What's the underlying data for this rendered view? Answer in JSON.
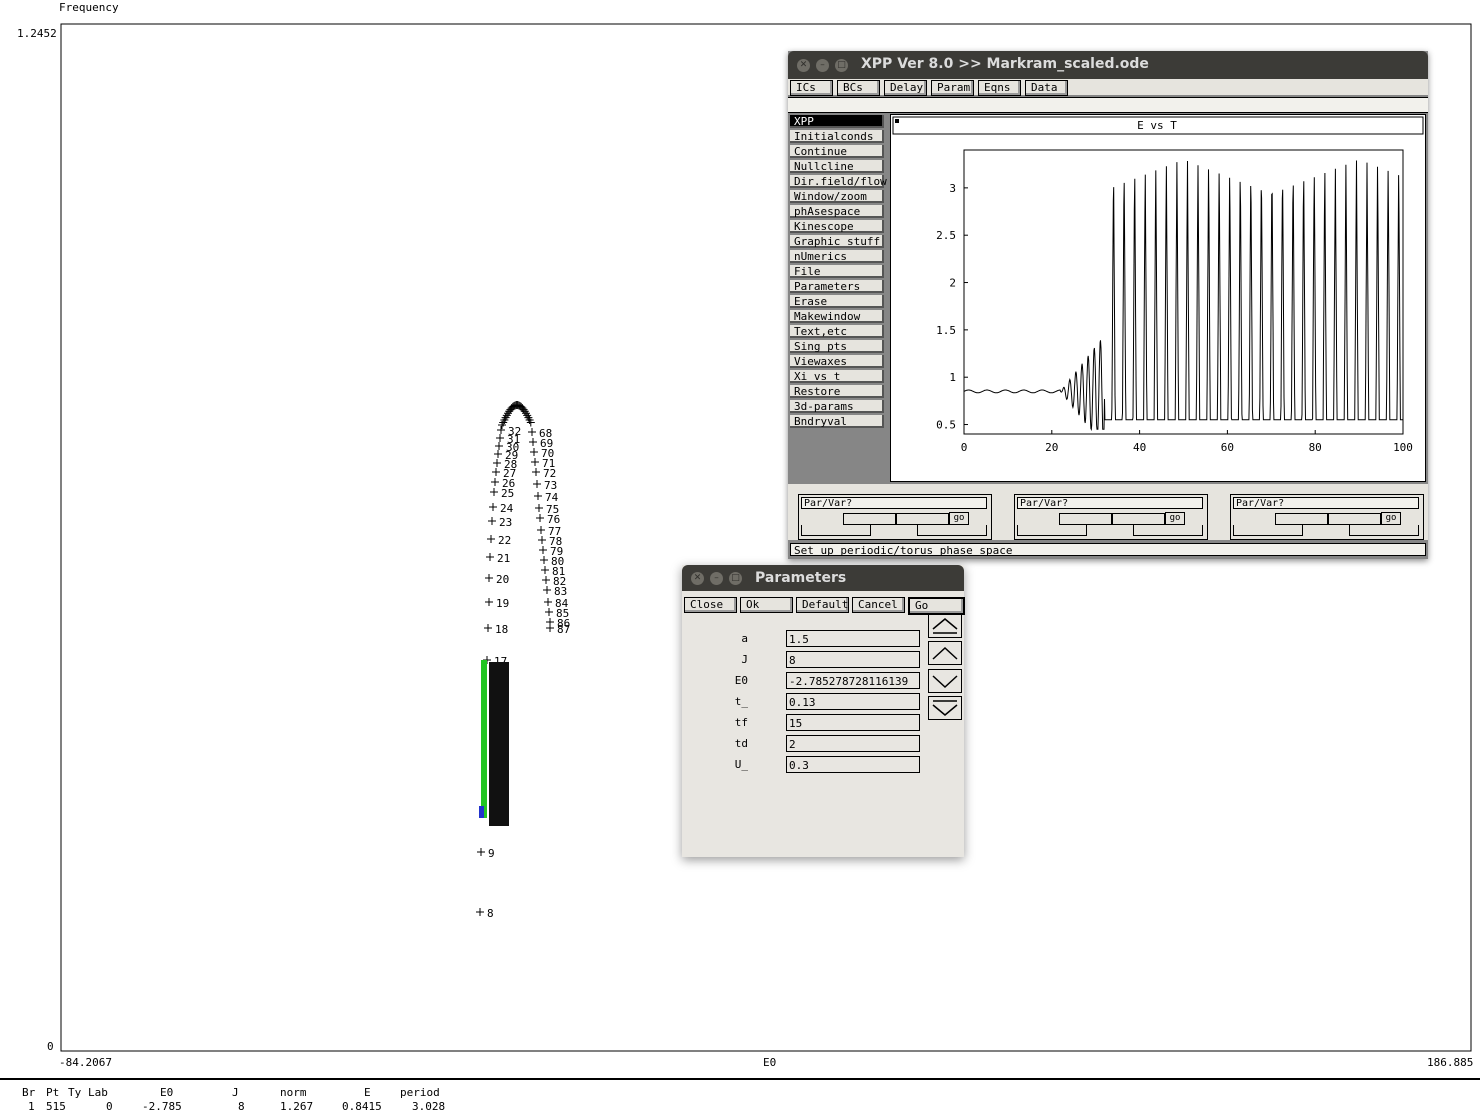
{
  "auto_plot": {
    "ylabel": "Frequency",
    "xlabel": "E0",
    "y_max_label": "1.2452",
    "y_min_label": "0",
    "x_min_label": "-84.2067",
    "x_max_label": "186.885",
    "point_labels": [
      "8",
      "9",
      "17",
      "18",
      "19",
      "20",
      "21",
      "22",
      "23",
      "24",
      "25",
      "26",
      "27",
      "28",
      "29",
      "30",
      "31",
      "32",
      "68",
      "69",
      "70",
      "71",
      "72",
      "73",
      "74",
      "75",
      "76",
      "77",
      "78",
      "79",
      "80",
      "81",
      "82",
      "83",
      "84",
      "85",
      "86",
      "87"
    ]
  },
  "status": {
    "headers": [
      "Br",
      "Pt",
      "Ty",
      "Lab",
      "E0",
      "J",
      "norm",
      "E",
      "period"
    ],
    "values": [
      "1",
      "515",
      "",
      "0",
      "-2.785",
      "8",
      "1.267",
      "0.8415",
      "3.028"
    ]
  },
  "xpp": {
    "title": "XPP Ver 8.0 >> Markram_scaled.ode",
    "top_buttons": [
      "ICs",
      "BCs",
      "Delay",
      "Param",
      "Eqns",
      "Data"
    ],
    "menu": [
      "XPP",
      "Initialconds",
      "Continue",
      "Nullcline",
      "Dir.field/flow",
      "Window/zoom",
      "phAsespace",
      "Kinescope",
      "Graphic stuff",
      "nUmerics",
      "File",
      "Parameters",
      "Erase",
      "Makewindow",
      "Text,etc",
      "Sing pts",
      "Viewaxes",
      "Xi vs t",
      "Restore",
      "3d-params",
      "Bndryval"
    ],
    "graph_title": "E vs T",
    "sliders": [
      {
        "label": "Par/Var?",
        "go": "go"
      },
      {
        "label": "Par/Var?",
        "go": "go"
      },
      {
        "label": "Par/Var?",
        "go": "go"
      }
    ],
    "status_text": "Set up periodic/torus phase space"
  },
  "chart_data": {
    "type": "line",
    "title": "E vs T",
    "xlabel": "",
    "ylabel": "",
    "xlim": [
      0,
      100
    ],
    "ylim": [
      0.4,
      3.4
    ],
    "x_ticks": [
      "0",
      "20",
      "40",
      "60",
      "80",
      "100"
    ],
    "y_ticks": [
      "0.5",
      "1",
      "1.5",
      "2",
      "2.5",
      "3"
    ],
    "series": [
      {
        "values_desc": "",
        "x": [
          0,
          5,
          10,
          15,
          20,
          22,
          24,
          26,
          28,
          30
        ],
        "y": [
          0.85,
          0.85,
          0.84,
          0.86,
          0.84,
          0.9,
          0.82,
          0.95,
          0.8,
          1.0
        ]
      }
    ]
  },
  "params": {
    "title": "Parameters",
    "buttons": [
      "Close",
      "Ok",
      "Default",
      "Cancel",
      "Go"
    ],
    "rows": [
      {
        "name": "a",
        "value": "1.5"
      },
      {
        "name": "J",
        "value": "8"
      },
      {
        "name": "E0",
        "value": "-2.785278728116139"
      },
      {
        "name": "t_",
        "value": "0.13"
      },
      {
        "name": "tf",
        "value": "15"
      },
      {
        "name": "td",
        "value": "2"
      },
      {
        "name": "U_",
        "value": "0.3"
      }
    ]
  }
}
